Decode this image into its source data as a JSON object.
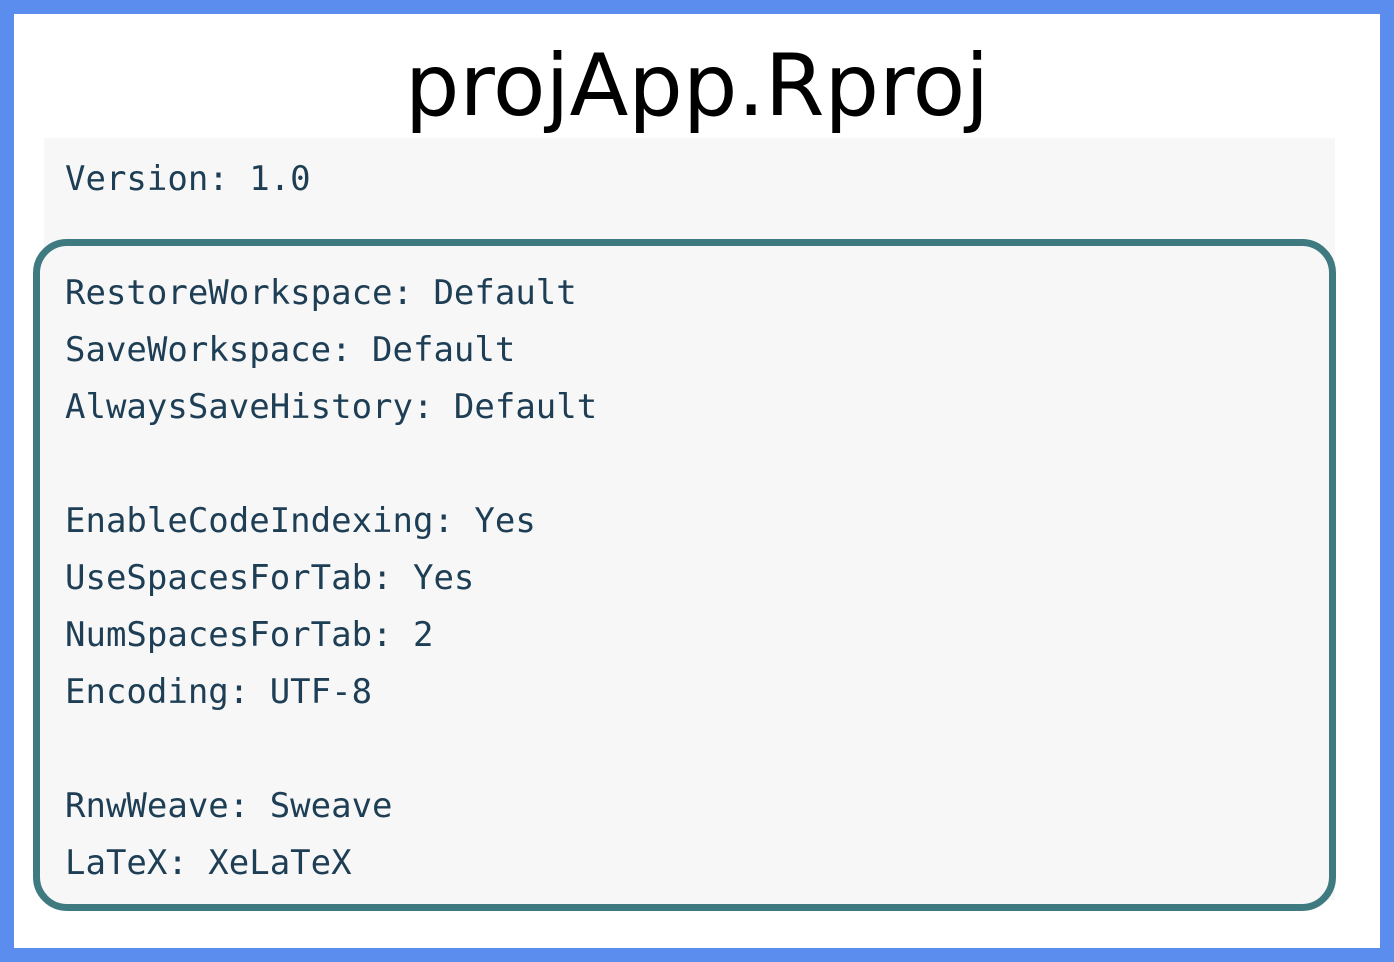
{
  "title": "projApp.Rproj",
  "lines": [
    "Version: 1.0",
    "RestoreWorkspace: Default",
    "SaveWorkspace: Default",
    "AlwaysSaveHistory: Default",
    "EnableCodeIndexing: Yes",
    "UseSpacesForTab: Yes",
    "NumSpacesForTab: 2",
    "Encoding: UTF-8",
    "RnwWeave: Sweave",
    "LaTeX: XeLaTeX"
  ],
  "colors": {
    "frame": "#5b8def",
    "highlight_border": "#3f7a80",
    "code_background": "#f7f7f7",
    "code_text": "#1d3e54"
  }
}
